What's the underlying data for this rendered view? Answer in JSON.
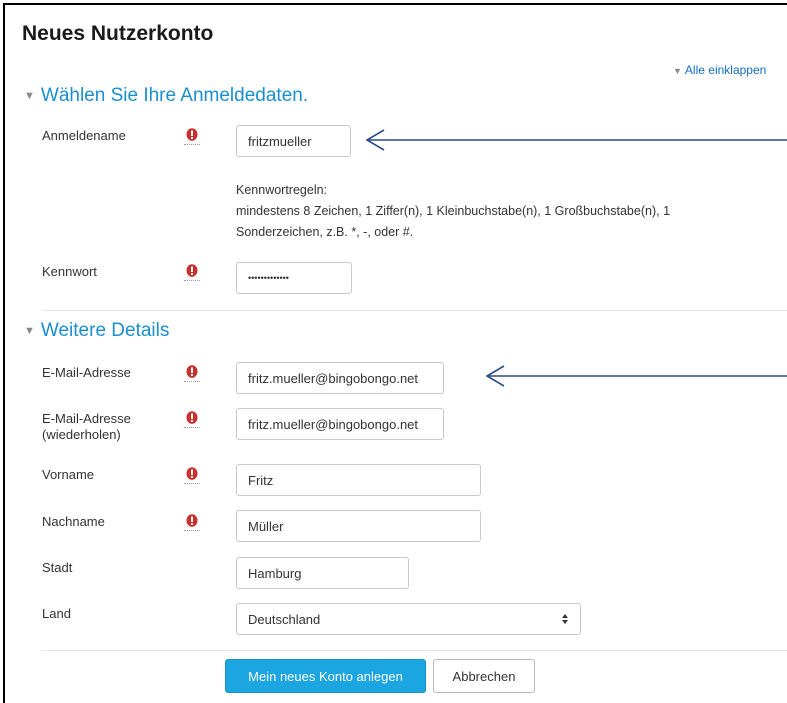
{
  "page": {
    "title": "Neues Nutzerkonto",
    "collapse_all": "Alle einklappen"
  },
  "sections": {
    "login": "Wählen Sie Ihre Anmeldedaten.",
    "details": "Weitere Details"
  },
  "fields": {
    "username": {
      "label": "Anmeldename",
      "value": "fritzmueller"
    },
    "password_rules": {
      "heading": "Kennwortregeln:",
      "line1": "mindestens 8 Zeichen, 1 Ziffer(n), 1 Kleinbuchstabe(n), 1 Großbuchstabe(n), 1",
      "line2": "Sonderzeichen, z.B. *, -, oder #."
    },
    "password": {
      "label": "Kennwort",
      "value": "•••••••••••••"
    },
    "email": {
      "label": "E-Mail-Adresse",
      "value": "fritz.mueller@bingobongo.net"
    },
    "email_repeat": {
      "label_line1": "E-Mail-Adresse",
      "label_line2": "(wiederholen)",
      "value": "fritz.mueller@bingobongo.net"
    },
    "firstname": {
      "label": "Vorname",
      "value": "Fritz"
    },
    "lastname": {
      "label": "Nachname",
      "value": "Müller"
    },
    "city": {
      "label": "Stadt",
      "value": "Hamburg"
    },
    "country": {
      "label": "Land",
      "value": "Deutschland"
    }
  },
  "buttons": {
    "submit": "Mein neues Konto anlegen",
    "cancel": "Abbrechen"
  },
  "icons": {
    "required": "exclamation-circle-icon",
    "select_arrows": "up-down-arrows-icon",
    "annotation": "arrow-left-icon"
  },
  "colors": {
    "accent": "#1a8fd0",
    "link": "#0f6fc5",
    "required": "#c9302c",
    "primary_button": "#1ba6e1",
    "annotation_arrow": "#2a4a8a"
  }
}
